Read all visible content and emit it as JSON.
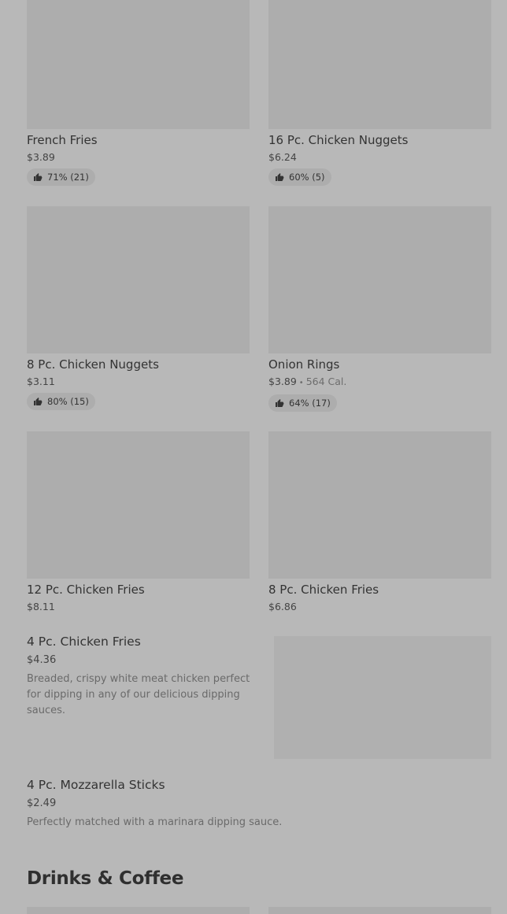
{
  "items": [
    {
      "name": "French Fries",
      "price": "$3.89",
      "rating": "71% (21)"
    },
    {
      "name": "16 Pc. Chicken Nuggets",
      "price": "$6.24",
      "rating": "60% (5)"
    },
    {
      "name": "8 Pc. Chicken Nuggets",
      "price": "$3.11",
      "rating": "80% (15)"
    },
    {
      "name": "Onion Rings",
      "price": "$3.89",
      "calories": "564 Cal.",
      "rating": "64% (17)"
    },
    {
      "name": "12 Pc. Chicken Fries",
      "price": "$8.11"
    },
    {
      "name": "8 Pc. Chicken Fries",
      "price": "$6.86"
    }
  ],
  "list_items": [
    {
      "name": "4 Pc. Chicken Fries",
      "price": "$4.36",
      "description": "Breaded, crispy white meat chicken perfect for dipping in any of our delicious dipping sauces."
    },
    {
      "name": "4 Pc. Mozzarella Sticks",
      "price": "$2.49",
      "description": "Perfectly matched with a marinara dipping sauce."
    }
  ],
  "section": {
    "title": "Drinks & Coffee"
  },
  "separator": "•",
  "icons": {
    "rating": "thumbs-up-icon"
  },
  "colors": {
    "background": "#b8b8b8",
    "placeholder": "#adadad"
  }
}
